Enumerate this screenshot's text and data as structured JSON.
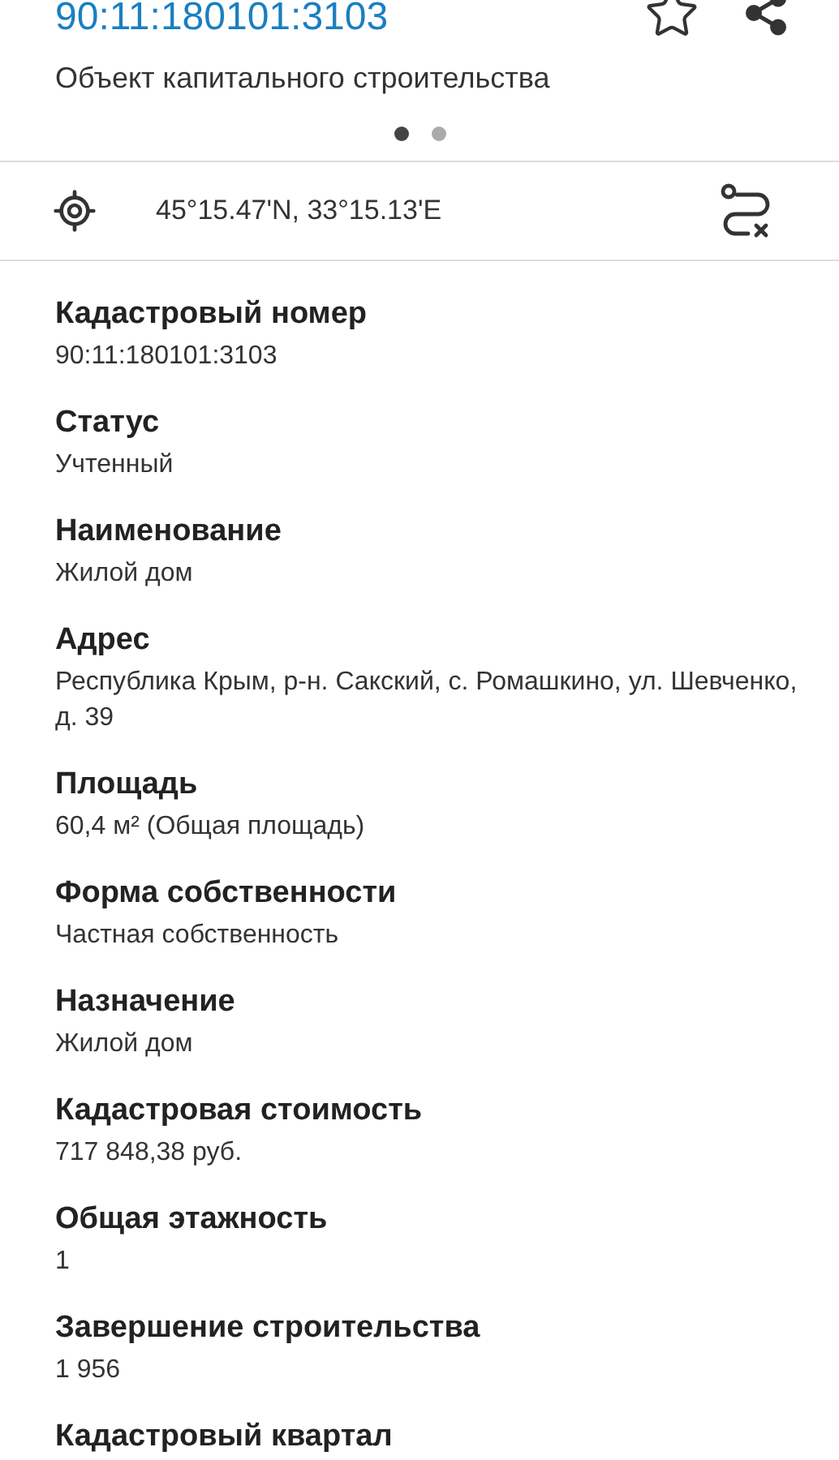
{
  "header": {
    "title": "90:11:180101:3103",
    "subtitle": "Объект капитального строительства",
    "favorite": false,
    "pager": [
      {
        "selected": true
      },
      {
        "selected": false
      }
    ]
  },
  "location": {
    "coordinates": "45°15.47'N, 33°15.13'E"
  },
  "fields": [
    {
      "label": "Кадастровый номер",
      "value": "90:11:180101:3103"
    },
    {
      "label": "Статус",
      "value": "Учтенный"
    },
    {
      "label": "Наименование",
      "value": "Жилой дом"
    },
    {
      "label": "Адрес",
      "value": "Республика Крым, р-н. Сакский, с. Ромашкино, ул. Шевченко, д. 39"
    },
    {
      "label": "Площадь",
      "value": "60,4 м² (Общая площадь)"
    },
    {
      "label": "Форма собственности",
      "value": "Частная собственность"
    },
    {
      "label": "Назначение",
      "value": "Жилой дом"
    },
    {
      "label": "Кадастровая стоимость",
      "value": "717 848,38 руб."
    },
    {
      "label": "Общая этажность",
      "value": "1"
    },
    {
      "label": "Завершение строительства",
      "value": "1 956"
    },
    {
      "label": "Кадастровый квартал"
    }
  ]
}
